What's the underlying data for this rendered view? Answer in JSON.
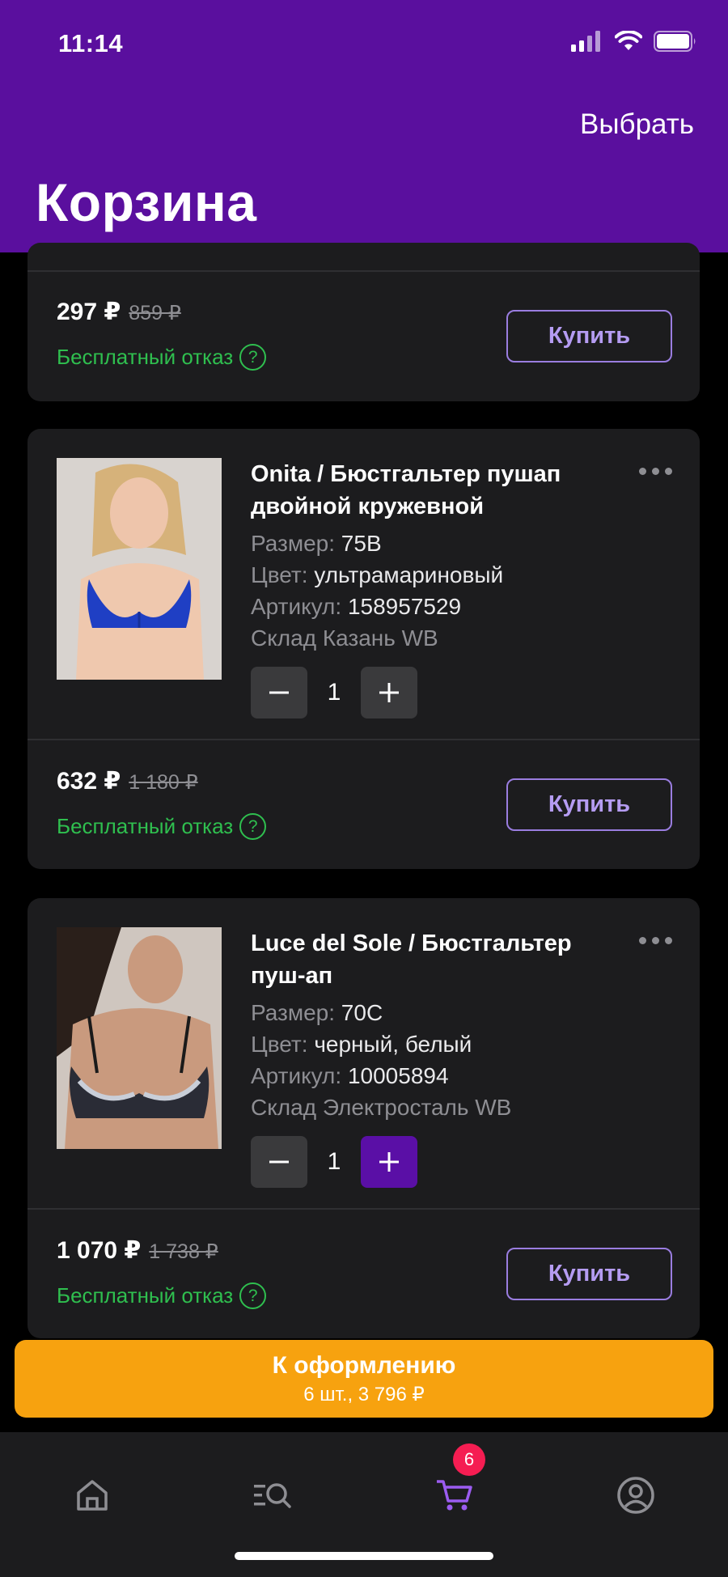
{
  "status_bar": {
    "time": "11:14"
  },
  "header": {
    "select_label": "Выбрать",
    "title": "Корзина"
  },
  "items": [
    {
      "price": "297 ₽",
      "old_price": "859 ₽",
      "free_refuse": "Бесплатный отказ",
      "buy_label": "Купить"
    },
    {
      "title": "Onita / Бюстгальтер пушап двойной кружевной",
      "size_label": "Размер:",
      "size": "75B",
      "color_label": "Цвет:",
      "color": "ультрамариновый",
      "article_label": "Артикул:",
      "article": "158957529",
      "warehouse": "Склад Казань WB",
      "quantity": "1",
      "price": "632 ₽",
      "old_price": "1 180 ₽",
      "free_refuse": "Бесплатный отказ",
      "buy_label": "Купить",
      "image_color": "#1f3fc4"
    },
    {
      "title": "Luce del Sole / Бюстгальтер пуш-ап",
      "size_label": "Размер:",
      "size": "70C",
      "color_label": "Цвет:",
      "color": "черный, белый",
      "article_label": "Артикул:",
      "article": "10005894",
      "warehouse": "Склад Электросталь WB",
      "quantity": "1",
      "price": "1 070 ₽",
      "old_price": "1 738 ₽",
      "free_refuse": "Бесплатный отказ",
      "buy_label": "Купить",
      "image_color": "#2a2c36"
    }
  ],
  "checkout": {
    "label": "К оформлению",
    "summary": "6 шт., 3 796 ₽"
  },
  "bottom_nav": {
    "cart_badge": "6",
    "items": [
      "home-icon",
      "catalog-search-icon",
      "cart-icon",
      "profile-icon"
    ]
  },
  "colors": {
    "header": "#5a0f9e",
    "accent": "#5a0fa6",
    "checkout": "#f7a20f",
    "success": "#2fbf4f",
    "badge": "#f51d52"
  }
}
